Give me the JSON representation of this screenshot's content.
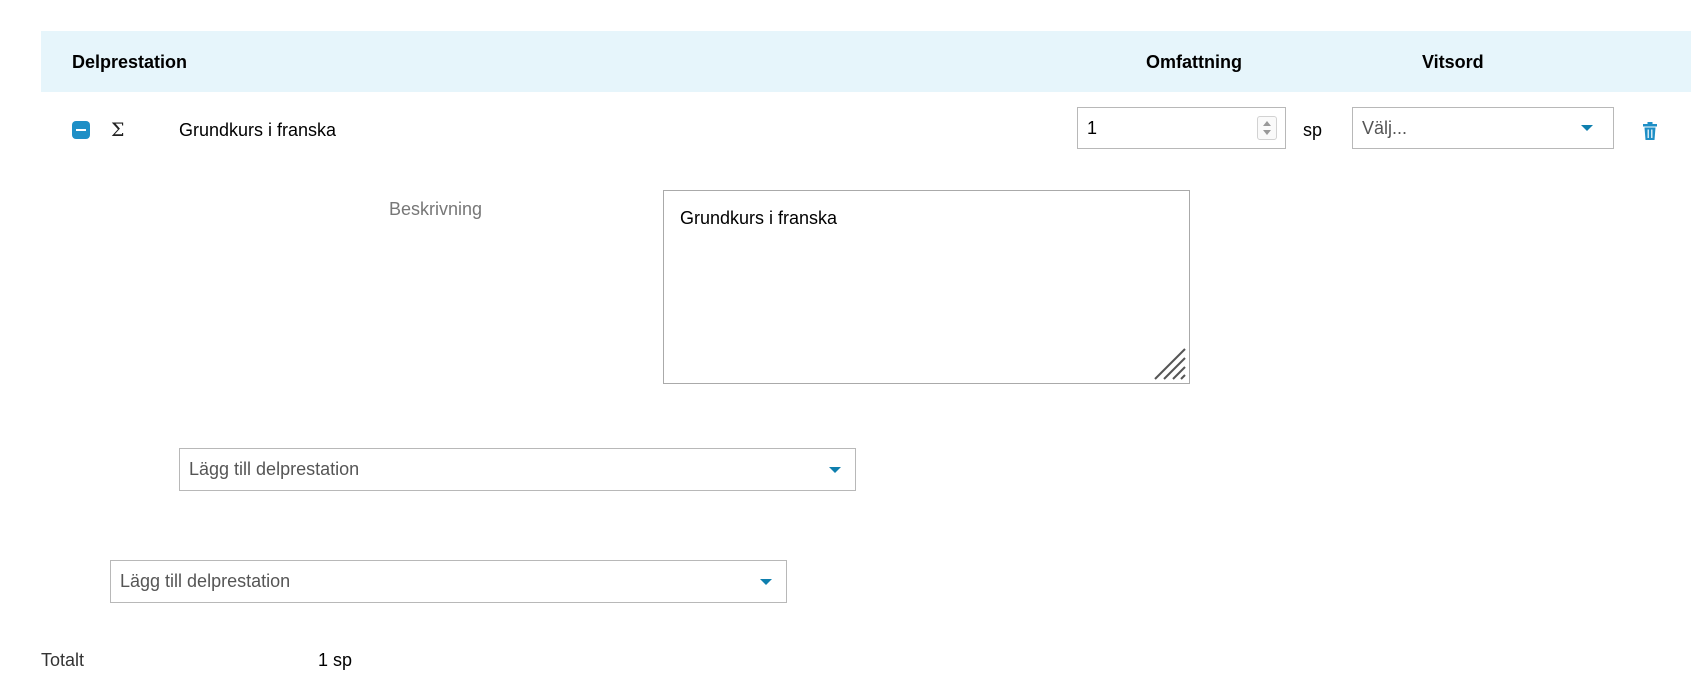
{
  "table": {
    "headers": {
      "delprestation": "Delprestation",
      "omfattning": "Omfattning",
      "vitsord": "Vitsord"
    },
    "row": {
      "name": "Grundkurs i franska",
      "omfattning_value": "1",
      "unit": "sp",
      "vitsord_placeholder": "Välj...",
      "description_label": "Beskrivning",
      "description_value": "Grundkurs i franska",
      "add_sub_placeholder": "Lägg till delprestation"
    },
    "add_placeholder": "Lägg till delprestation"
  },
  "summary": {
    "total_label": "Totalt",
    "total_value": "1 sp"
  },
  "icons": {
    "collapse": "minus-square-icon",
    "sigma": "sigma-icon",
    "delete": "trash-icon",
    "resize": "resize-handle-icon"
  },
  "colors": {
    "header_bg": "#e6f5fb",
    "accent": "#1e8fc6",
    "caret": "#0e7fae"
  }
}
